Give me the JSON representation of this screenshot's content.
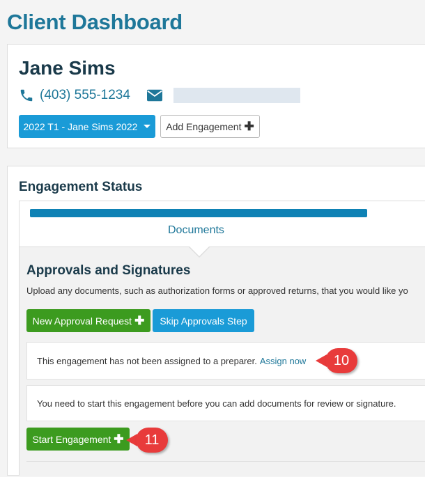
{
  "page": {
    "title": "Client Dashboard"
  },
  "client": {
    "name": "Jane Sims",
    "phone": "(403) 555-1234",
    "engagement_select": "2022 T1 - Jane Sims 2022",
    "add_engagement_label": "Add Engagement"
  },
  "status": {
    "title": "Engagement Status",
    "step_label": "Documents",
    "progress_pct": 100
  },
  "approvals": {
    "title": "Approvals and Signatures",
    "description": "Upload any documents, such as authorization forms or approved returns, that you would like yo",
    "new_request_label": "New Approval Request",
    "skip_label": "Skip Approvals Step",
    "unassigned_text": "This engagement has not been assigned to a preparer.",
    "assign_link": "Assign now",
    "start_notice": "You need to start this engagement before you can add documents for review or signature.",
    "start_label": "Start Engagement"
  },
  "callouts": {
    "first": "10",
    "second": "11"
  },
  "colors": {
    "accent": "#1e7799",
    "button_blue": "#1a9bd7",
    "button_green": "#3c9b1f",
    "progress": "#0f82b5",
    "callout_red": "#e83b3b"
  }
}
